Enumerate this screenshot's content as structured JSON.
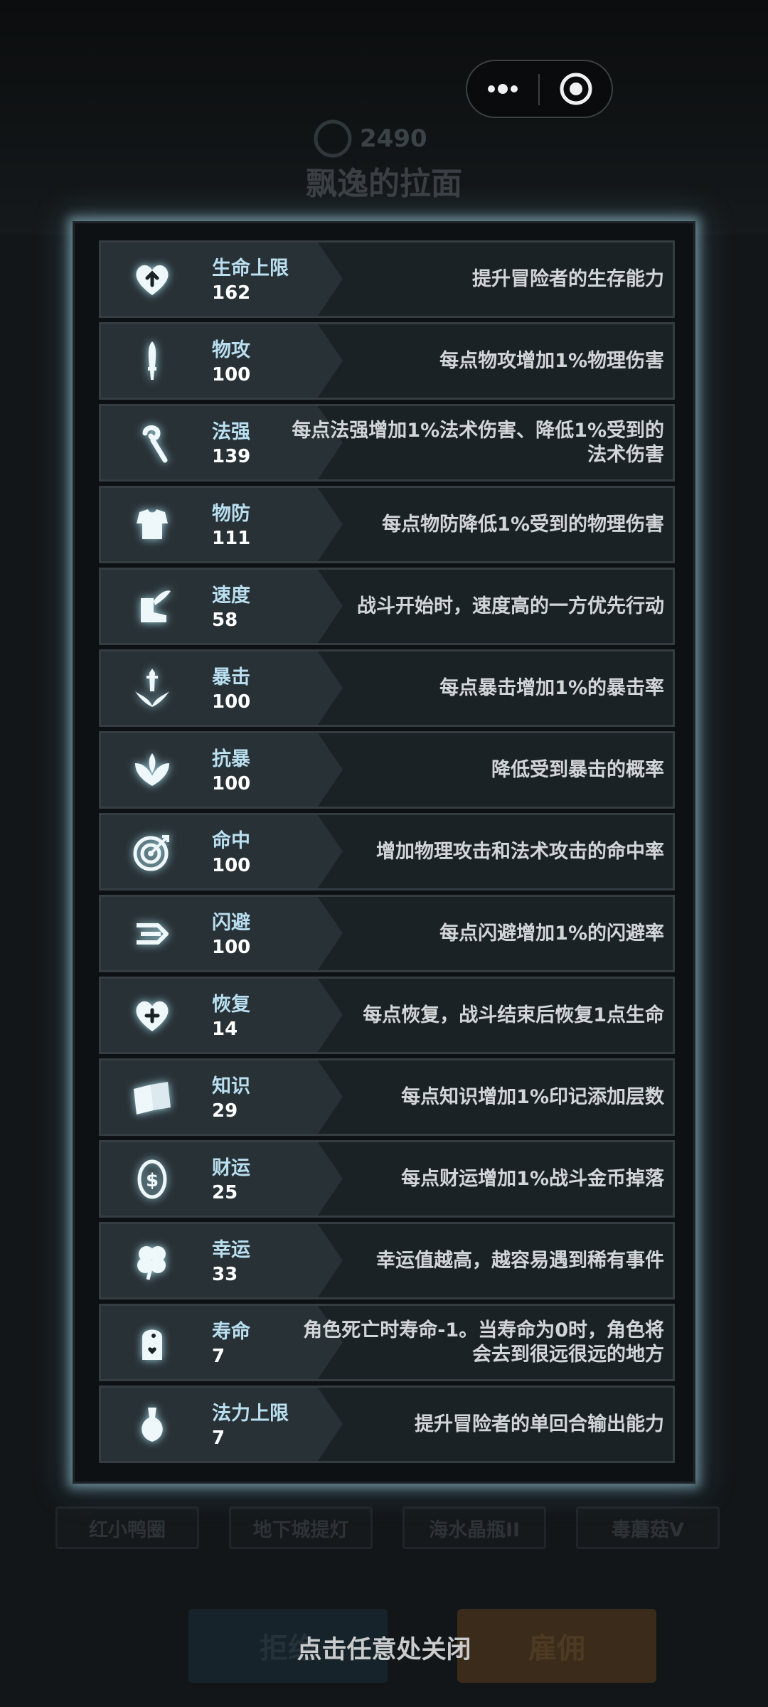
{
  "background": {
    "coin_amount": "2490",
    "item_name": "飘逸的拉面",
    "tags": [
      "红小鸭圈",
      "地下城提灯",
      "海水晶瓶II",
      "毒蘑菇V"
    ],
    "reject_label": "拒绝",
    "hire_label": "雇佣"
  },
  "close_hint": "点击任意处关闭",
  "colors": {
    "label": "#b9dff0",
    "value": "#ffffff",
    "desc": "#d3d6d8",
    "glow": "#a0d2e1"
  },
  "stats": [
    {
      "icon": "heart-up-icon",
      "label": "生命上限",
      "value": "162",
      "desc": "提升冒险者的生存能力"
    },
    {
      "icon": "sword-icon",
      "label": "物攻",
      "value": "100",
      "desc": "每点物攻增加1%物理伤害"
    },
    {
      "icon": "staff-icon",
      "label": "法强",
      "value": "139",
      "desc": "每点法强增加1%法术伤害、降低1%受到的\n法术伤害"
    },
    {
      "icon": "armor-icon",
      "label": "物防",
      "value": "111",
      "desc": "每点物防降低1%受到的物理伤害"
    },
    {
      "icon": "winged-boot-icon",
      "label": "速度",
      "value": "58",
      "desc": "战斗开始时，速度高的一方优先行动"
    },
    {
      "icon": "crit-sword-icon",
      "label": "暴击",
      "value": "100",
      "desc": "每点暴击增加1%的暴击率"
    },
    {
      "icon": "anti-crit-icon",
      "label": "抗暴",
      "value": "100",
      "desc": "降低受到暴击的概率"
    },
    {
      "icon": "target-icon",
      "label": "命中",
      "value": "100",
      "desc": "增加物理攻击和法术攻击的命中率"
    },
    {
      "icon": "dodge-arrows-icon",
      "label": "闪避",
      "value": "100",
      "desc": "每点闪避增加1%的闪避率"
    },
    {
      "icon": "heart-plus-icon",
      "label": "恢复",
      "value": "14",
      "desc": "每点恢复，战斗结束后恢复1点生命"
    },
    {
      "icon": "book-icon",
      "label": "知识",
      "value": "29",
      "desc": "每点知识增加1%印记添加层数"
    },
    {
      "icon": "coin-icon",
      "label": "财运",
      "value": "25",
      "desc": "每点财运增加1%战斗金币掉落"
    },
    {
      "icon": "clover-icon",
      "label": "幸运",
      "value": "33",
      "desc": "幸运值越高，越容易遇到稀有事件"
    },
    {
      "icon": "tombstone-icon",
      "label": "寿命",
      "value": "7",
      "desc": "角色死亡时寿命-1。当寿命为0时，角色将\n会去到很远很远的地方"
    },
    {
      "icon": "mana-flask-icon",
      "label": "法力上限",
      "value": "7",
      "desc": "提升冒险者的单回合输出能力"
    }
  ]
}
